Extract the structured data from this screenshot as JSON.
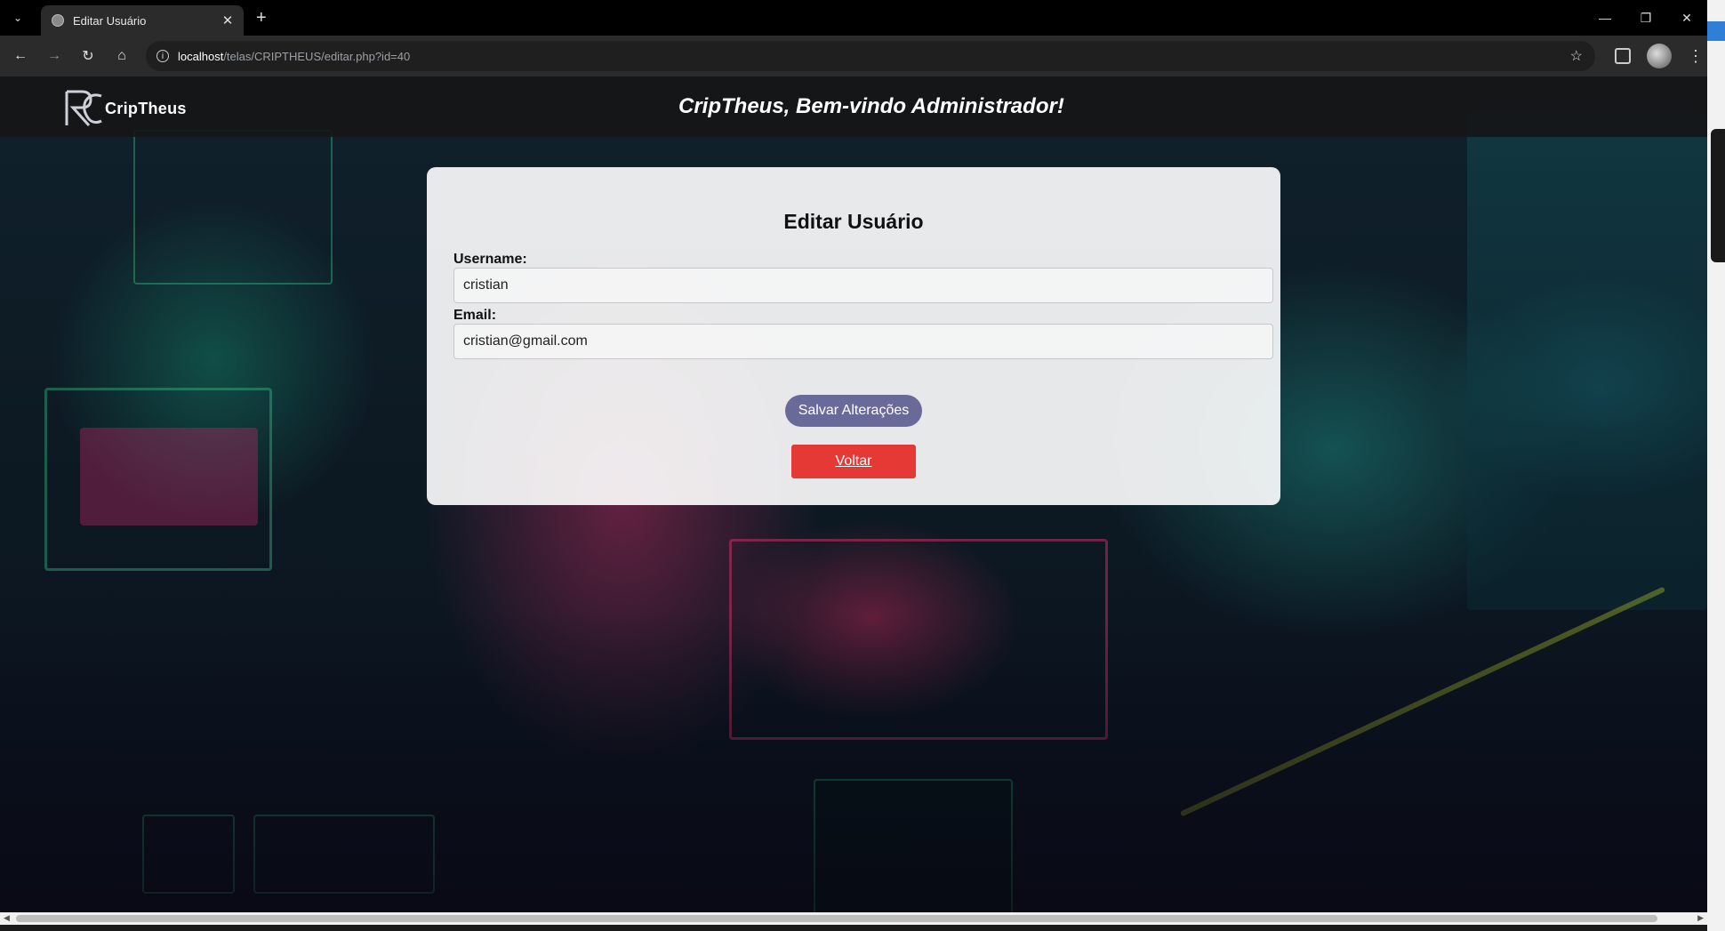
{
  "browser": {
    "tab_title": "Editar Usuário",
    "url_host": "localhost",
    "url_path": "/telas/CRIPTHEUS/editar.php?id=40"
  },
  "header": {
    "logo_text": "CripTheus",
    "welcome": "CripTheus, Bem-vindo Administrador!"
  },
  "form": {
    "title": "Editar Usuário",
    "username_label": "Username:",
    "username_value": "cristian",
    "email_label": "Email:",
    "email_value": "cristian@gmail.com",
    "save_label": "Salvar Alterações",
    "back_label": "Voltar"
  },
  "colors": {
    "save_button": "#6a6a9a",
    "back_button": "#e53935",
    "card_bg": "rgba(255,255,255,0.9)"
  }
}
